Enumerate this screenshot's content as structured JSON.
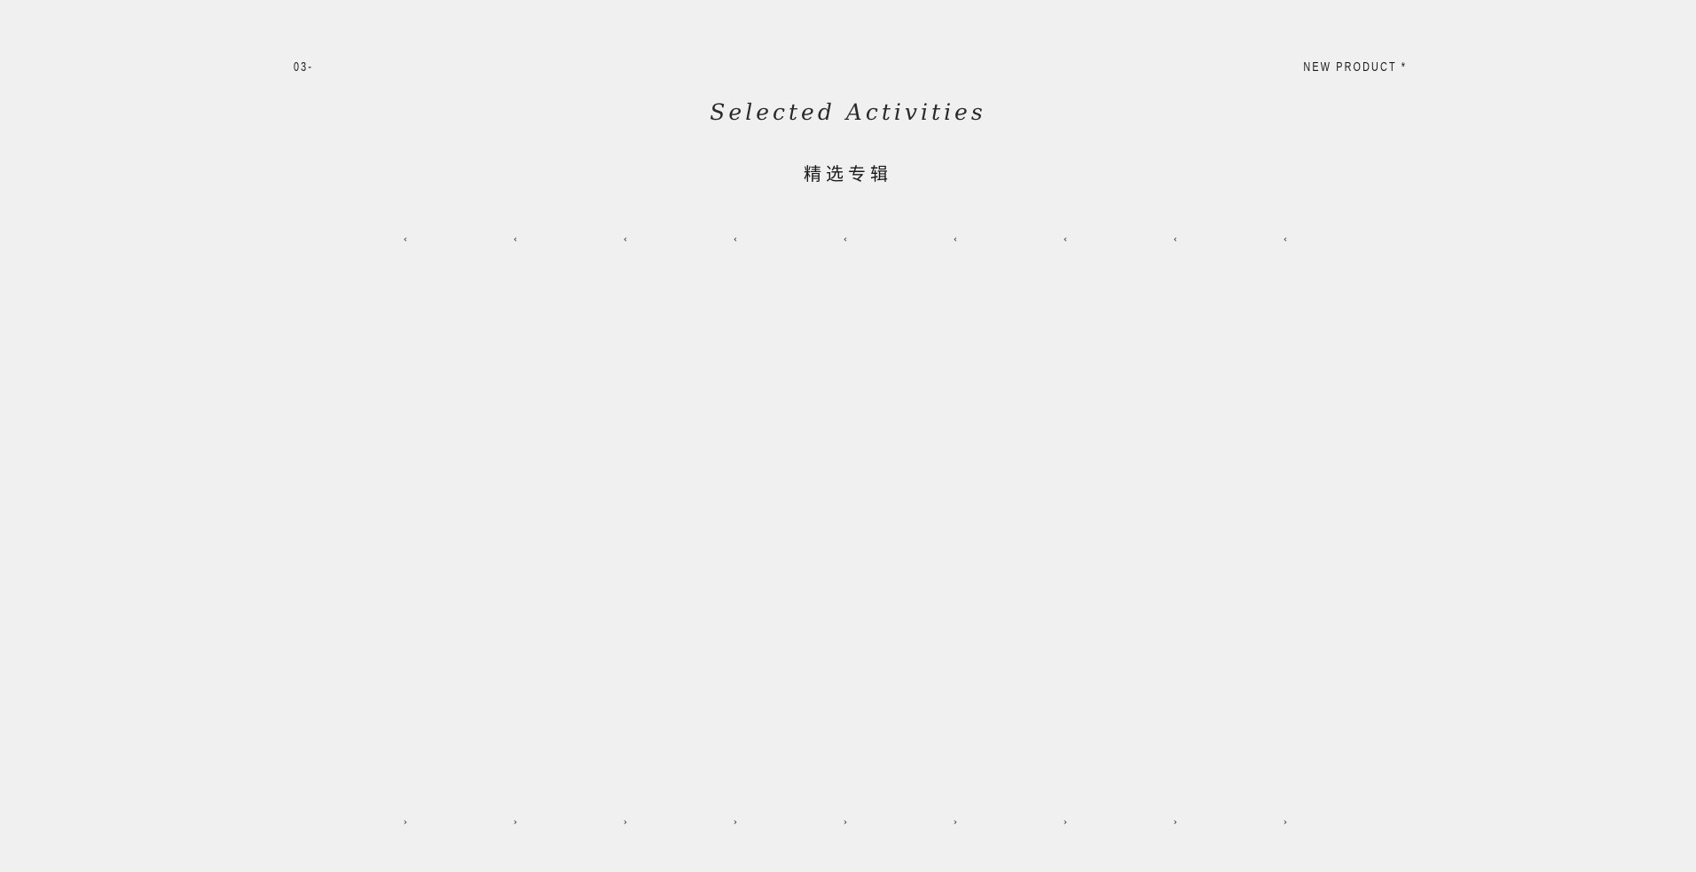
{
  "header": {
    "section_number": "03-",
    "section_tag": "NEW PRODUCT *"
  },
  "titles": {
    "script": "Selected Activities",
    "chinese": "精选专辑"
  },
  "carousel": {
    "prev_arrows": [
      "‹",
      "‹",
      "‹",
      "‹",
      "‹",
      "‹",
      "‹",
      "‹",
      "‹"
    ],
    "next_arrows": [
      "›",
      "›",
      "›",
      "›",
      "›",
      "›",
      "›",
      "›",
      "›"
    ]
  }
}
